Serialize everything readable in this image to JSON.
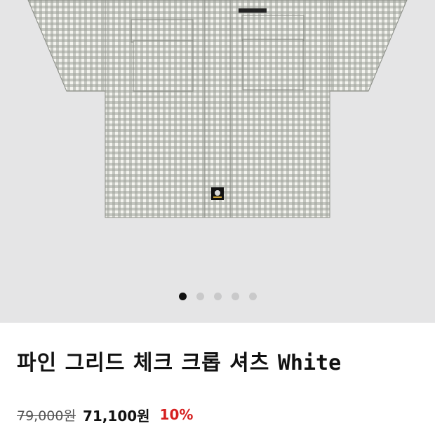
{
  "product": {
    "title_ko": "파인 그리드 체크 크롭 셔츠",
    "title_en": "White",
    "original_price": "79,000원",
    "sale_price": "71,100원",
    "discount": "10%"
  },
  "gallery": {
    "total_images": 5,
    "active_index": 0
  },
  "colors": {
    "gallery_bg": "#e5e5e6",
    "active_dot": "#111111",
    "inactive_dot": "#c9c9ca",
    "discount": "#d62020"
  }
}
